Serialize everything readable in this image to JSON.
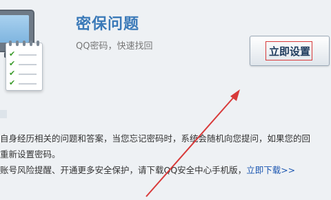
{
  "header": {
    "title": "密保问题",
    "subtitle": "QQ密码，快速找回"
  },
  "setup_button": {
    "label": "立即设置"
  },
  "body": {
    "line1": "自身经历相关的问题和答案，当您忘记密码时，系统会随机向您提问，如果您的回",
    "line2": "重新设置密码。",
    "line3_text": "账号风险提醒、开通更多安全保护，请下载QQ安全中心手机版，",
    "line3_link": "立即下载>>"
  },
  "illustration": {
    "icons": [
      "monitor-icon",
      "checklist-icon"
    ]
  },
  "colors": {
    "background": "#eef1f4",
    "title": "#3a79b8",
    "link": "#1a55b0",
    "highlight_box": "#d83a3a",
    "arrow": "#d83a3a"
  }
}
